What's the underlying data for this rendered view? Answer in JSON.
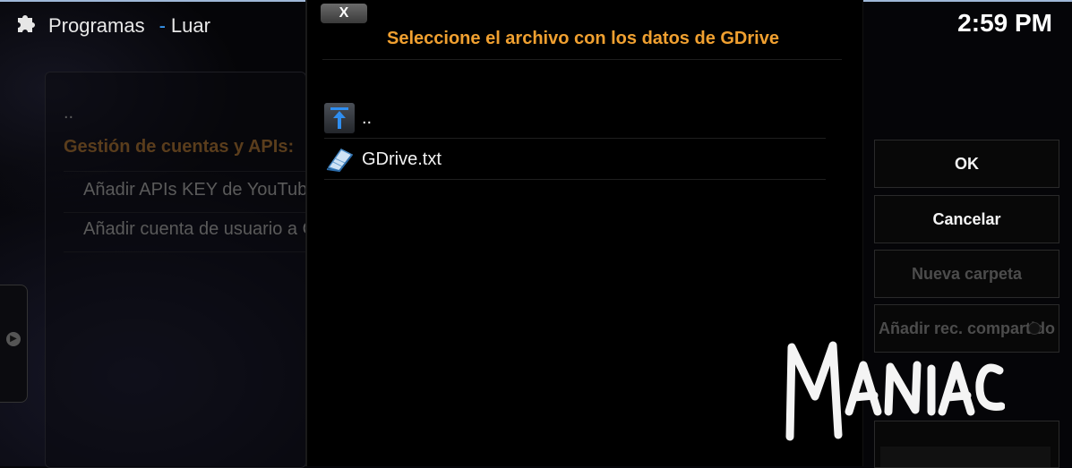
{
  "header": {
    "app_icon": "puzzle-icon",
    "section": "Programas",
    "separator": "-",
    "addon": "Luar",
    "clock": "2:59 PM"
  },
  "background_list": {
    "parent": "..",
    "heading": "Gestión de cuentas y APIs:",
    "items": [
      "Añadir APIs KEY de YouTube",
      "Añadir cuenta de usuario a GDrive"
    ]
  },
  "dialog": {
    "close_label": "X",
    "title": "Seleccione el archivo con los datos de GDrive",
    "files": [
      {
        "label": "..",
        "icon": "folder-up-icon"
      },
      {
        "label": "GDrive.txt",
        "icon": "text-file-icon"
      }
    ]
  },
  "buttons": {
    "ok": "OK",
    "cancel": "Cancelar",
    "new_folder": "Nueva carpeta",
    "add_share": "Añadir rec. compartido"
  },
  "watermark": "MANIAC",
  "colors": {
    "title": "#f0a030",
    "accent": "#3aa0ff",
    "text": "#f2f2f2",
    "disabled": "#4c4c4c"
  }
}
